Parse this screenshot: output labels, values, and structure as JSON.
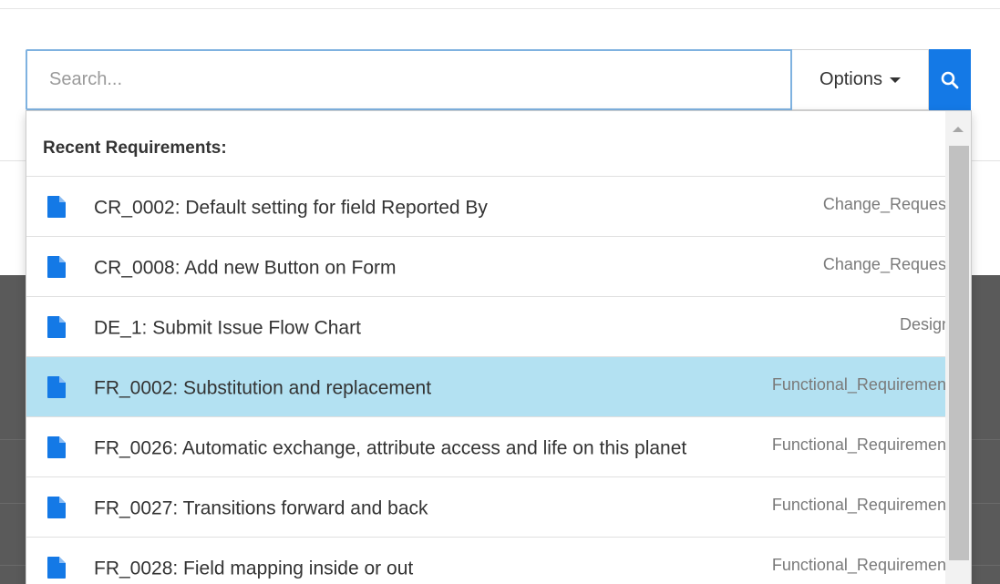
{
  "search": {
    "placeholder": "Search...",
    "value": ""
  },
  "options_label": "Options",
  "dropdown": {
    "header": "Recent Requirements:",
    "items": [
      {
        "label": "CR_0002: Default setting for field Reported By",
        "type": "Change_Request",
        "selected": false
      },
      {
        "label": "CR_0008: Add new Button on Form",
        "type": "Change_Request",
        "selected": false
      },
      {
        "label": "DE_1: Submit Issue Flow Chart",
        "type": "Design",
        "selected": false
      },
      {
        "label": "FR_0002: Substitution and replacement",
        "type": "Functional_Requirement",
        "selected": true
      },
      {
        "label": "FR_0026: Automatic exchange, attribute access and life on this planet",
        "type": "Functional_Requirement",
        "selected": false
      },
      {
        "label": "FR_0027: Transitions forward and back",
        "type": "Functional_Requirement",
        "selected": false
      },
      {
        "label": "FR_0028: Field mapping inside or out",
        "type": "Functional_Requirement",
        "selected": false
      }
    ]
  },
  "icons": {
    "search_button": "search-icon",
    "item": "document-icon",
    "options": "caret-down-icon"
  },
  "colors": {
    "accent": "#1479e6",
    "selected_row": "#b3e1f2",
    "doc_icon": "#1479e6",
    "input_focus_border": "#7fb2e0"
  }
}
